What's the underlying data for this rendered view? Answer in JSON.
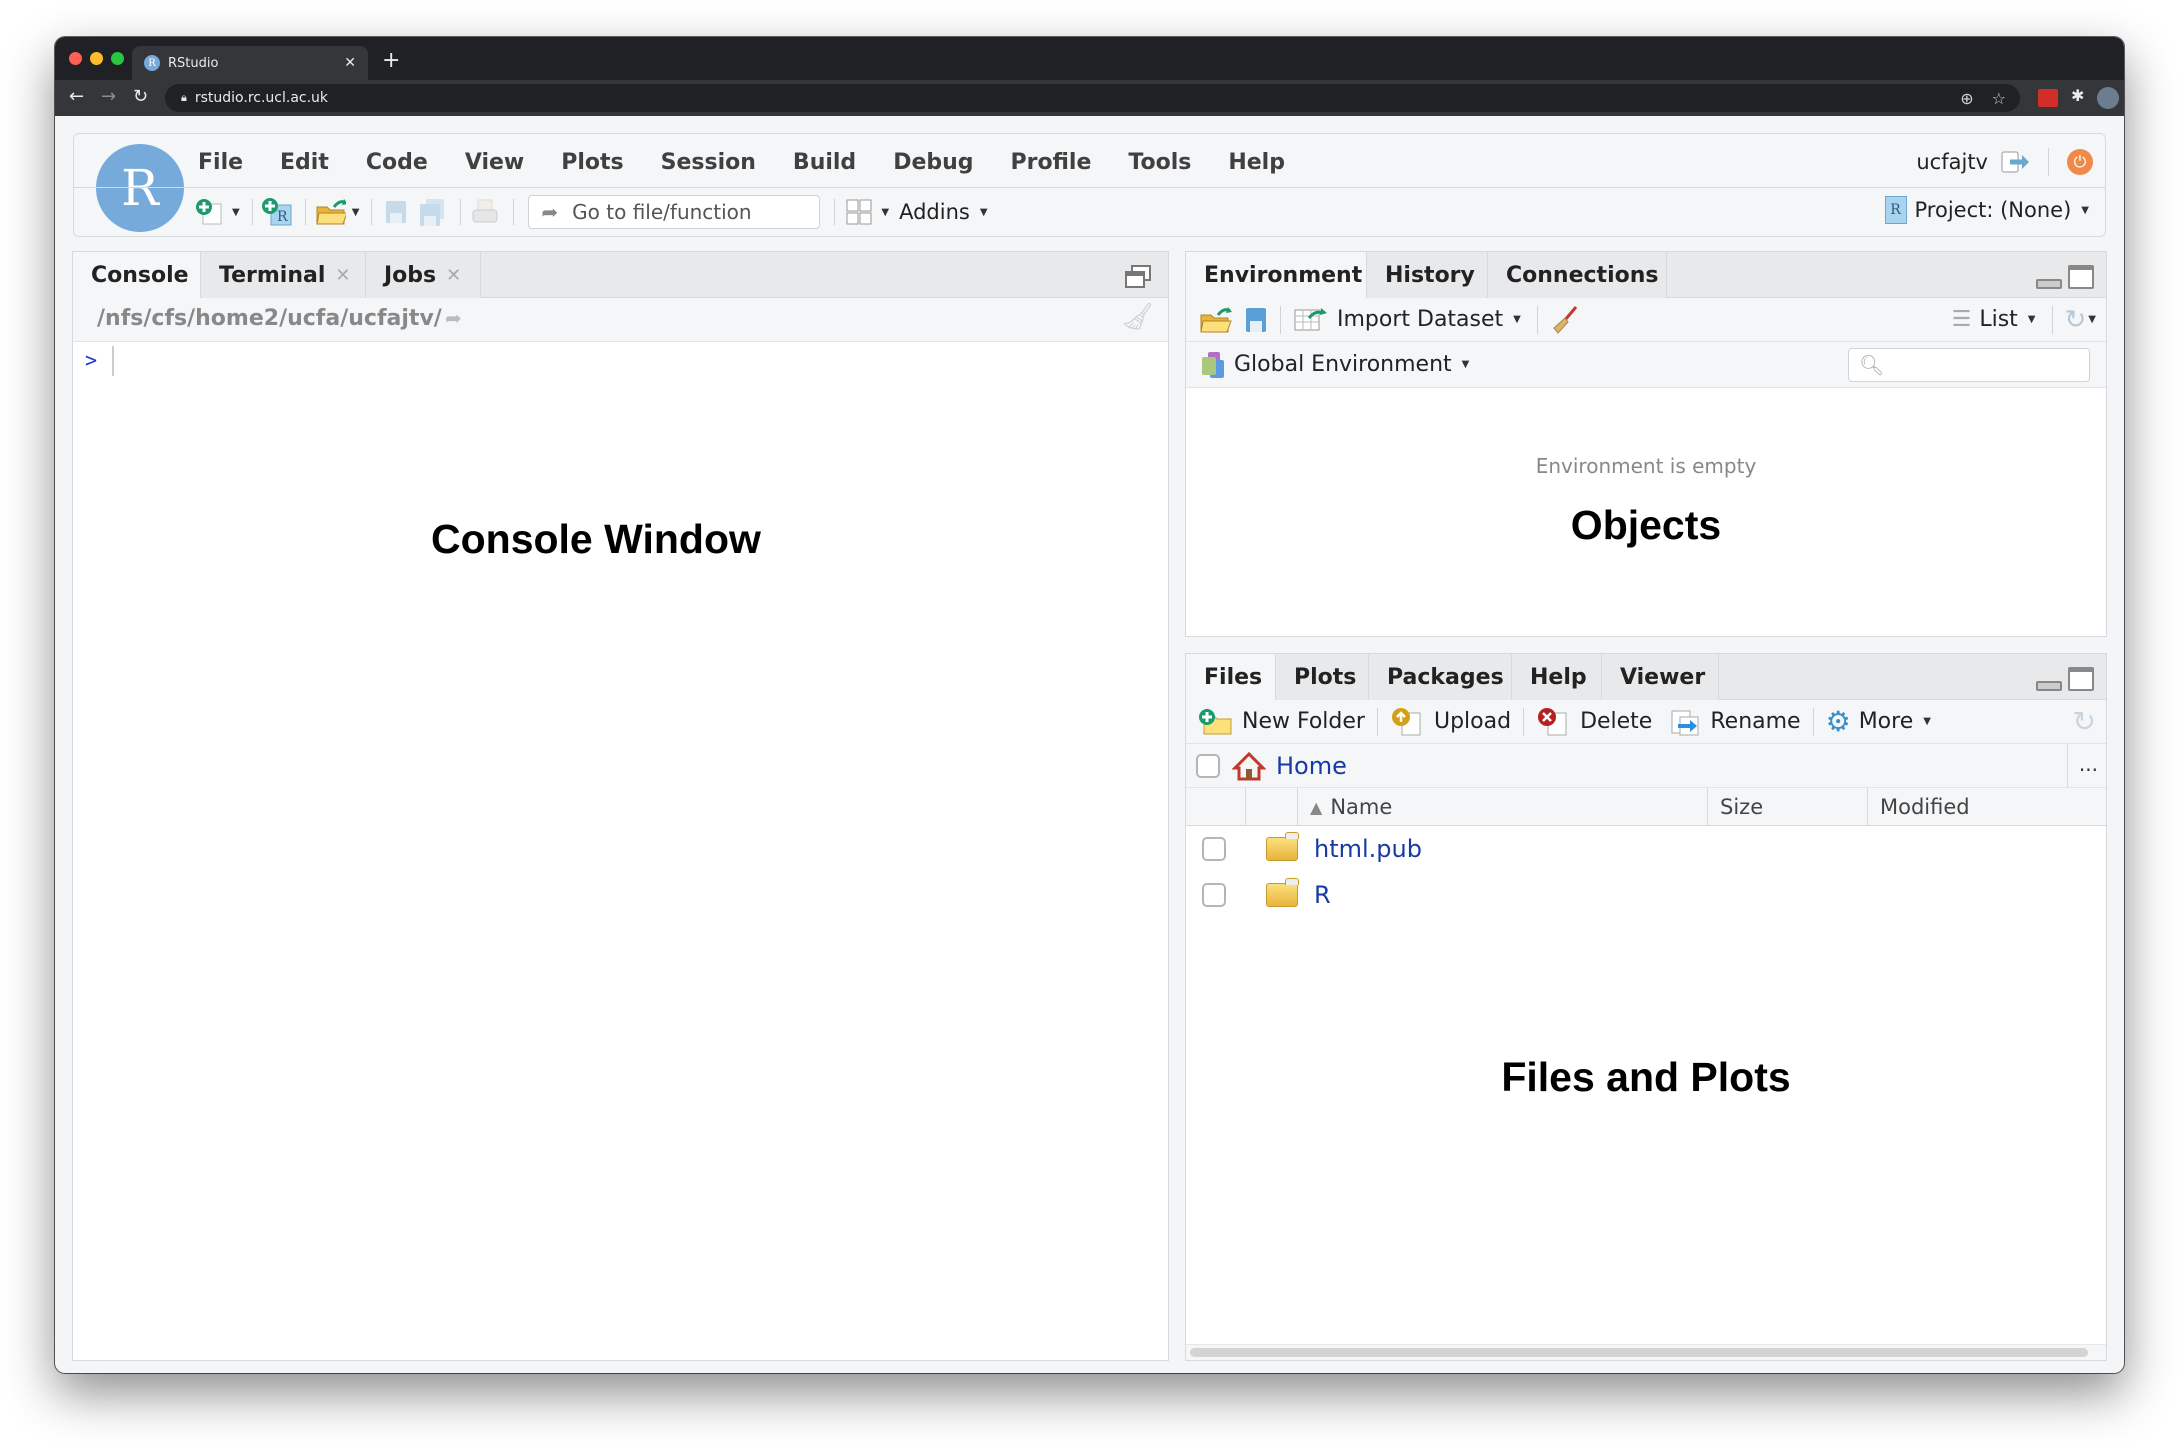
{
  "browser": {
    "tab_title": "RStudio",
    "tab_favicon": "R",
    "url": "rstudio.rc.ucl.ac.uk",
    "traffic_lights": [
      "#ff5f57",
      "#febc2e",
      "#28c840"
    ]
  },
  "header": {
    "logo": "R",
    "menus": [
      "File",
      "Edit",
      "Code",
      "View",
      "Plots",
      "Session",
      "Build",
      "Debug",
      "Profile",
      "Tools",
      "Help"
    ],
    "goto_placeholder": "Go to file/function",
    "addins_label": "Addins",
    "username": "ucfajtv",
    "project_label": "Project: (None)"
  },
  "console_pane": {
    "tabs": [
      {
        "label": "Console",
        "closable": false,
        "active": true
      },
      {
        "label": "Terminal",
        "closable": true,
        "active": false
      },
      {
        "label": "Jobs",
        "closable": true,
        "active": false
      }
    ],
    "path": "/nfs/cfs/home2/ucfa/ucfajtv/",
    "prompt": ">",
    "annotation": "Console Window"
  },
  "environment_pane": {
    "tabs": [
      {
        "label": "Environment",
        "active": true
      },
      {
        "label": "History",
        "active": false
      },
      {
        "label": "Connections",
        "active": false
      }
    ],
    "toolbar": {
      "import_label": "Import Dataset",
      "view_mode": "List"
    },
    "scope_label": "Global Environment",
    "search_placeholder": "",
    "empty_message": "Environment is empty",
    "annotation": "Objects"
  },
  "files_pane": {
    "tabs": [
      {
        "label": "Files",
        "active": true
      },
      {
        "label": "Plots",
        "active": false
      },
      {
        "label": "Packages",
        "active": false
      },
      {
        "label": "Help",
        "active": false
      },
      {
        "label": "Viewer",
        "active": false
      }
    ],
    "toolbar": {
      "new_folder": "New Folder",
      "upload": "Upload",
      "delete": "Delete",
      "rename": "Rename",
      "more": "More"
    },
    "breadcrumb": "Home",
    "more_dots": "...",
    "columns": {
      "name": "Name",
      "size": "Size",
      "modified": "Modified",
      "sort_indicator": "▲"
    },
    "rows": [
      {
        "name": "html.pub",
        "type": "folder",
        "size": "",
        "modified": ""
      },
      {
        "name": "R",
        "type": "folder",
        "size": "",
        "modified": ""
      }
    ],
    "annotation": "Files and Plots"
  }
}
